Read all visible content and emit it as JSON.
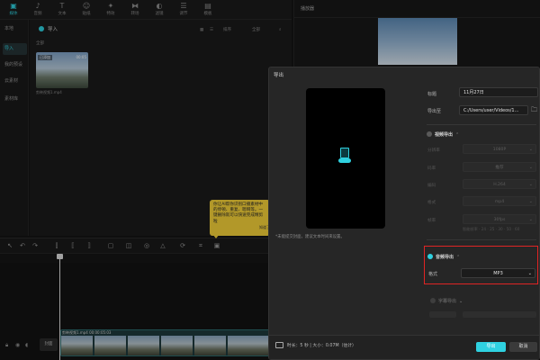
{
  "topbar": {
    "tools": [
      {
        "label": "媒体",
        "icon": "media-icon",
        "glyph": "▣",
        "active": true
      },
      {
        "label": "音频",
        "icon": "audio-icon",
        "glyph": "♪",
        "active": false
      },
      {
        "label": "文本",
        "icon": "text-icon",
        "glyph": "T",
        "active": false
      },
      {
        "label": "贴纸",
        "icon": "sticker-icon",
        "glyph": "☺",
        "active": false
      },
      {
        "label": "特效",
        "icon": "effects-icon",
        "glyph": "✦",
        "active": false
      },
      {
        "label": "转场",
        "icon": "transition-icon",
        "glyph": "⧓",
        "active": false
      },
      {
        "label": "滤镜",
        "icon": "filter-icon",
        "glyph": "◐",
        "active": false
      },
      {
        "label": "调节",
        "icon": "adjust-icon",
        "glyph": "☰",
        "active": false
      },
      {
        "label": "模板",
        "icon": "template-icon",
        "glyph": "▤",
        "active": false
      }
    ]
  },
  "sidebar": {
    "items": [
      {
        "label": "本地",
        "active": false
      },
      {
        "label": "导入",
        "active": true
      },
      {
        "label": "我的预设",
        "active": false
      },
      {
        "label": "云素材",
        "active": false
      },
      {
        "label": "素材库",
        "active": false
      }
    ]
  },
  "media": {
    "import_label": "导入",
    "sort_label": "排序",
    "all_label": "全部",
    "section_label": "全部",
    "thumb_added": "已添加",
    "thumb_duration": "00:05",
    "thumb_name": "剪映视频1.mp4"
  },
  "player": {
    "title": "播放器"
  },
  "tooltip": {
    "text": "你让AI帮你识别口播素材中的停顿、重复、嗯啊等。一键删除就可以快速完成精剪啦",
    "button": "知道了"
  },
  "timeline": {
    "cover_label": "封面",
    "clip_label": "剪映视频1.mp4  00:00:05:03"
  },
  "export_dialog": {
    "title": "导出",
    "preview_note": "*未能提交封面，建议文本时间来设置。",
    "title_label": "标题",
    "title_value": "11月27日",
    "path_label": "导出至",
    "path_value": "C:/Users/user/Videos/1...",
    "video_section": {
      "label": "视频导出",
      "enabled": false,
      "fields": [
        {
          "label": "分辨率",
          "value": "1080P"
        },
        {
          "label": "码率",
          "value": "推荐"
        },
        {
          "label": "编码",
          "value": "H.264"
        },
        {
          "label": "格式",
          "value": "mp4"
        },
        {
          "label": "帧率",
          "value": "30fps"
        }
      ],
      "fps_note": "智能帧率 · 24 · 25 · 30 · 50 · 60"
    },
    "audio_section": {
      "label": "音频导出",
      "enabled": true,
      "format_label": "格式",
      "format_value": "MP3"
    },
    "subtitle_section": {
      "label": "字幕导出",
      "enabled": false
    },
    "footer": {
      "info": "时长：5 秒 | 大小：0.07M（估计）",
      "export_button": "导出",
      "cancel_button": "取消"
    }
  },
  "colors": {
    "accent": "#2fd1e0",
    "highlight_box": "#e02424",
    "tooltip": "#f7d33a",
    "dialog_bg": "#262626"
  }
}
